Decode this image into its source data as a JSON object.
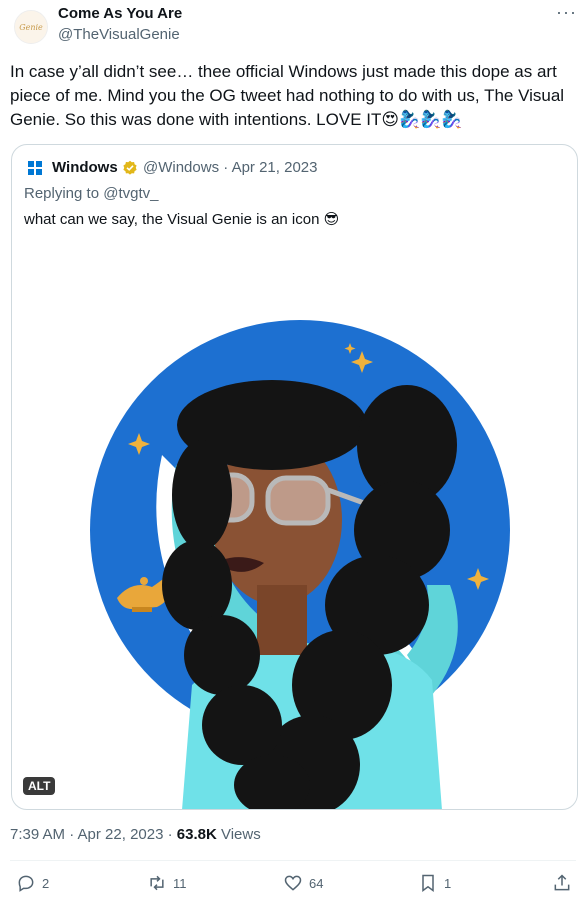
{
  "header": {
    "display_name": "Come As You Are",
    "handle": "@TheVisualGenie",
    "avatar_text": "Genie",
    "more_label": "···"
  },
  "tweet": {
    "text": "In case y’all didn’t see… thee official Windows just made this dope as art piece of me. Mind you the OG tweet had nothing to do with us, The Visual Genie. So this was done with intentions. LOVE IT😍🧞‍♀️🧞‍♀️🧞‍♀️"
  },
  "quote": {
    "name": "Windows",
    "handle_date": "@Windows · Apr 21, 2023",
    "replying_prefix": "Replying to ",
    "replying_to": "@tvgtv_",
    "text": "what can we say, the Visual Genie is an icon 😎",
    "alt_badge": "ALT",
    "verified_color": "#e2b719"
  },
  "meta": {
    "time_date": "7:39 AM · Apr 22, 2023 · ",
    "views_count": "63.8K",
    "views_label": " Views"
  },
  "actions": {
    "replies": "2",
    "retweets": "11",
    "likes": "64",
    "bookmarks": "1"
  },
  "colors": {
    "accent_blue": "#1d70d1",
    "teal": "#5fd4d9",
    "text_secondary": "#536471"
  }
}
